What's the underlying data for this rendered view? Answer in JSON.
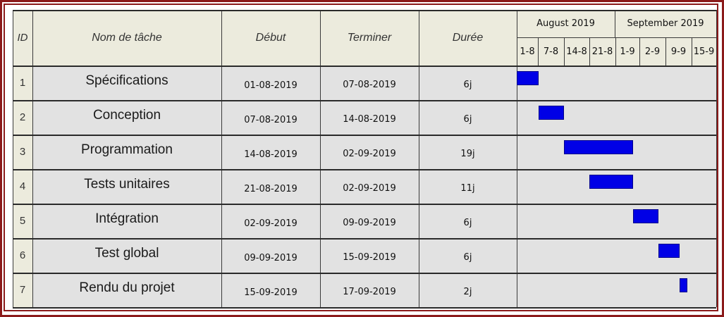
{
  "headers": {
    "id": "ID",
    "task": "Nom de tâche",
    "start": "Début",
    "end": "Terminer",
    "duration": "Durée"
  },
  "months": [
    {
      "label": "August 2019"
    },
    {
      "label": "September 2019"
    }
  ],
  "weeks": [
    "1-8",
    "7-8",
    "14-8",
    "21-8",
    "1-9",
    "2-9",
    "9-9",
    "15-9"
  ],
  "tasks": [
    {
      "id": "1",
      "name": "Spécifications",
      "start": "01-08-2019",
      "end": "07-08-2019",
      "duration": "6j"
    },
    {
      "id": "2",
      "name": "Conception",
      "start": "07-08-2019",
      "end": "14-08-2019",
      "duration": "6j"
    },
    {
      "id": "3",
      "name": "Programmation",
      "start": "14-08-2019",
      "end": "02-09-2019",
      "duration": "19j"
    },
    {
      "id": "4",
      "name": "Tests unitaires",
      "start": "21-08-2019",
      "end": "02-09-2019",
      "duration": "11j"
    },
    {
      "id": "5",
      "name": "Intégration",
      "start": "02-09-2019",
      "end": "09-09-2019",
      "duration": "6j"
    },
    {
      "id": "6",
      "name": "Test global",
      "start": "09-09-2019",
      "end": "15-09-2019",
      "duration": "6j"
    },
    {
      "id": "7",
      "name": "Rendu du projet",
      "start": "15-09-2019",
      "end": "17-09-2019",
      "duration": "2j"
    }
  ],
  "colors": {
    "bar": "#0000e6",
    "frame": "#8b1a1a",
    "header_bg": "#ecebdd",
    "row_bg": "#e2e2e2"
  },
  "chart_data": {
    "type": "gantt",
    "time_axis": [
      "1-8",
      "7-8",
      "14-8",
      "21-8",
      "1-9",
      "2-9",
      "9-9",
      "15-9"
    ],
    "bars": [
      {
        "task": "Spécifications",
        "start": "01-08-2019",
        "end": "07-08-2019"
      },
      {
        "task": "Conception",
        "start": "07-08-2019",
        "end": "14-08-2019"
      },
      {
        "task": "Programmation",
        "start": "14-08-2019",
        "end": "02-09-2019"
      },
      {
        "task": "Tests unitaires",
        "start": "21-08-2019",
        "end": "02-09-2019"
      },
      {
        "task": "Intégration",
        "start": "02-09-2019",
        "end": "09-09-2019"
      },
      {
        "task": "Test global",
        "start": "09-09-2019",
        "end": "15-09-2019"
      },
      {
        "task": "Rendu du projet",
        "start": "15-09-2019",
        "end": "17-09-2019"
      }
    ]
  }
}
